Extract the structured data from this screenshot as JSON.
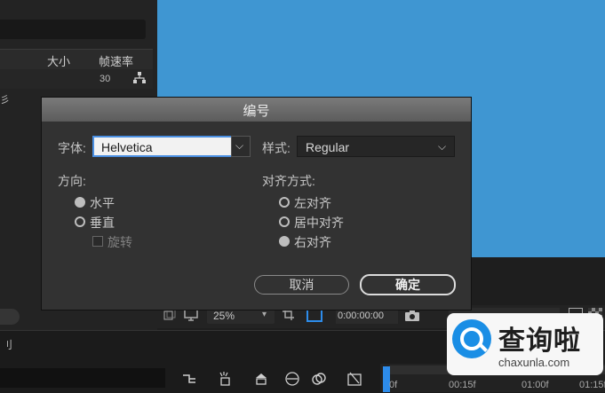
{
  "background": {
    "panel_header": {
      "size": "大小",
      "frame_rate": "帧速率"
    },
    "panel_row": {
      "frame_rate_value": "30"
    },
    "left_fragment": "彡",
    "viewer_toolbar": {
      "magnification": "25%",
      "timecode": "0:00:00:00"
    },
    "timeline": {
      "left_text": "刂",
      "ruler_labels": [
        "0f",
        "00:15f",
        "01:00f",
        "01:15f"
      ]
    },
    "colors": {
      "viewer_bg": "#3f96d2",
      "playhead": "#2d8ceb"
    }
  },
  "dialog": {
    "title": "编号",
    "font_label": "字体:",
    "font_value": "Helvetica",
    "style_label": "样式:",
    "style_value": "Regular",
    "direction_label": "方向:",
    "direction_options": [
      "水平",
      "垂直"
    ],
    "rotate_label": "旋转",
    "align_label": "对齐方式:",
    "align_options": [
      "左对齐",
      "居中对齐",
      "右对齐"
    ],
    "cancel_label": "取消",
    "ok_label": "确定"
  },
  "watermark": {
    "text": "查询啦",
    "domain": "chaxunla.com"
  }
}
